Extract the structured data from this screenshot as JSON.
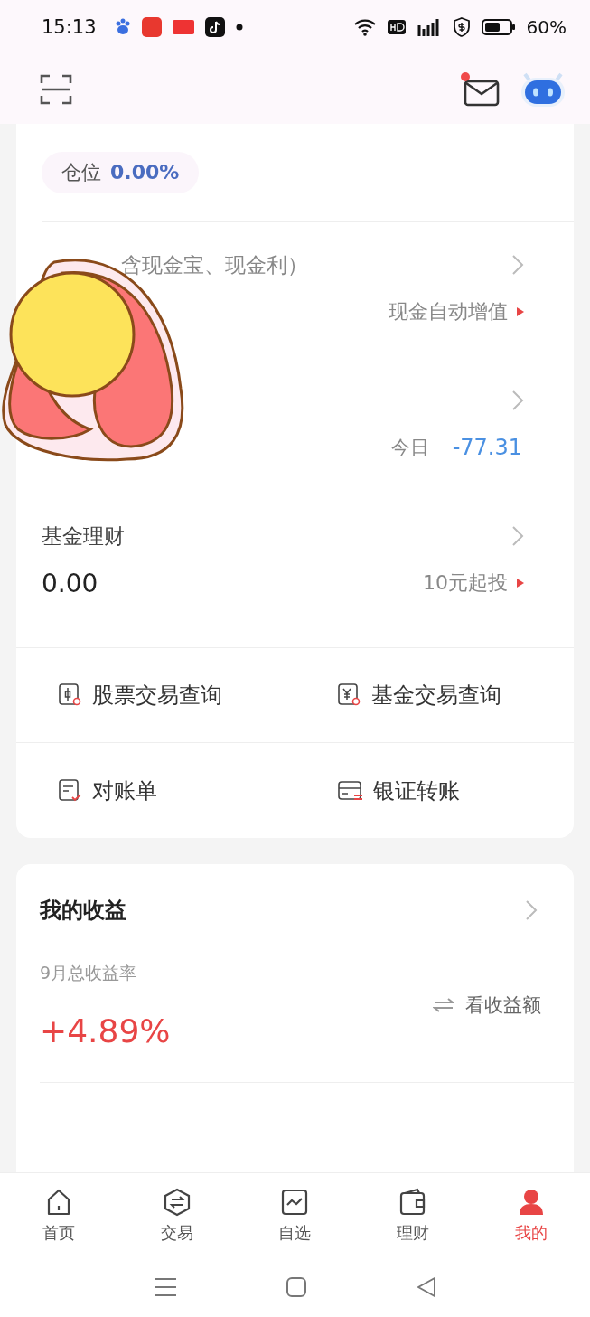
{
  "status_bar": {
    "time": "15:13",
    "battery": "60%"
  },
  "position_pill": {
    "label": "仓位",
    "value": "0.00%"
  },
  "asset_rows": [
    {
      "title": "含现金宝、现金利）",
      "tag": "现金自动增值"
    },
    {
      "today_label": "今日",
      "today_value": "-77.31"
    },
    {
      "title": "基金理财",
      "value": "0.00",
      "tag": "10元起投"
    }
  ],
  "quick_links": [
    {
      "kind": "stock-query",
      "label": "股票交易查询"
    },
    {
      "kind": "fund-query",
      "label": "基金交易查询"
    },
    {
      "kind": "statement",
      "label": "对账单"
    },
    {
      "kind": "transfer",
      "label": "银证转账"
    }
  ],
  "earnings": {
    "title": "我的收益",
    "period_label": "9月总收益率",
    "rate": "+4.89%",
    "toggle": "看收益额"
  },
  "tabs": [
    {
      "label": "首页",
      "selected": false
    },
    {
      "label": "交易",
      "selected": false
    },
    {
      "label": "自选",
      "selected": false
    },
    {
      "label": "理财",
      "selected": false
    },
    {
      "label": "我的",
      "selected": true
    }
  ]
}
